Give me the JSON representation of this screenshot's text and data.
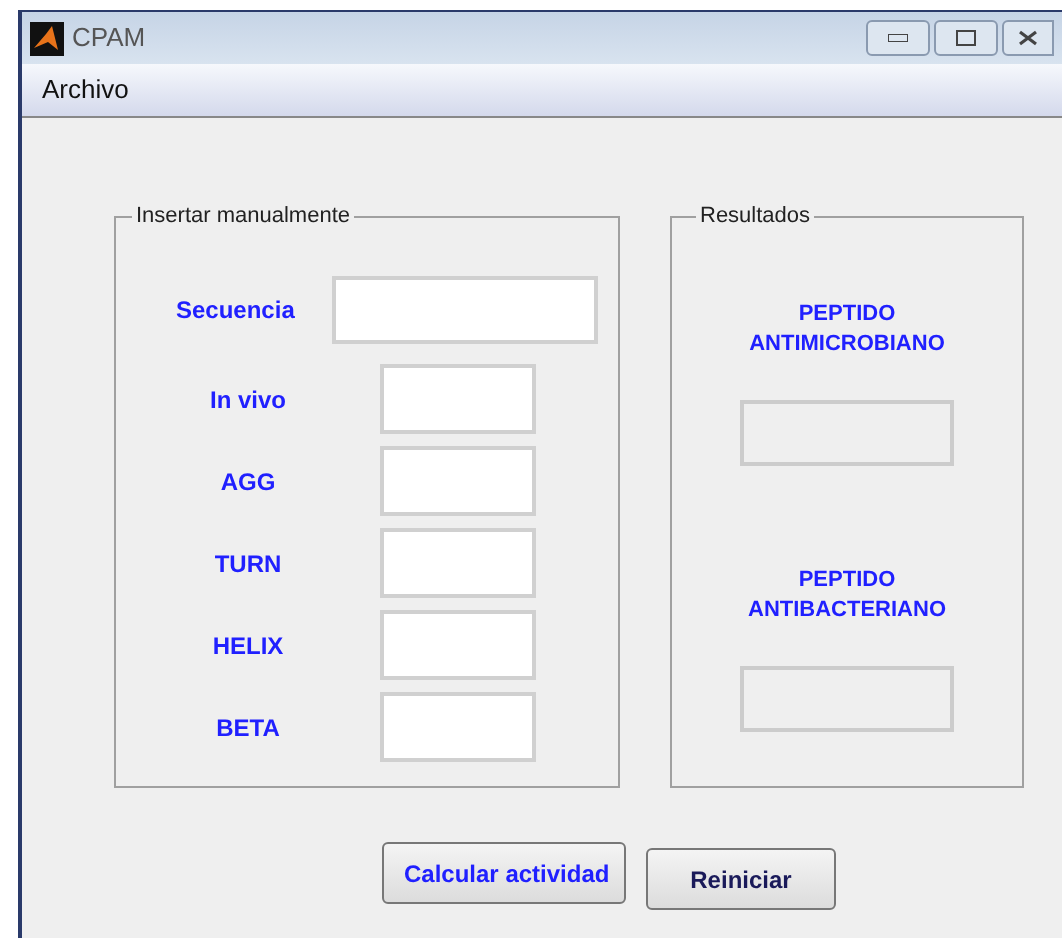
{
  "window": {
    "title": "CPAM"
  },
  "menu": [
    "Archivo"
  ],
  "input_panel": {
    "title": "Insertar manualmente",
    "sequence": {
      "label": "Secuencia"
    },
    "fields": [
      {
        "label": "In vivo"
      },
      {
        "label": "AGG"
      },
      {
        "label": "TURN"
      },
      {
        "label": "HELIX"
      },
      {
        "label": "BETA"
      }
    ]
  },
  "results_panel": {
    "title": "Resultados",
    "results": [
      {
        "label": "PEPTIDO ANTIMICROBIANO"
      },
      {
        "label": "PEPTIDO ANTIBACTERIANO"
      }
    ]
  },
  "buttons": [
    {
      "label": "Calcular actividad",
      "kind": "primary"
    },
    {
      "label": "Reiniciar",
      "kind": "secondary"
    }
  ]
}
